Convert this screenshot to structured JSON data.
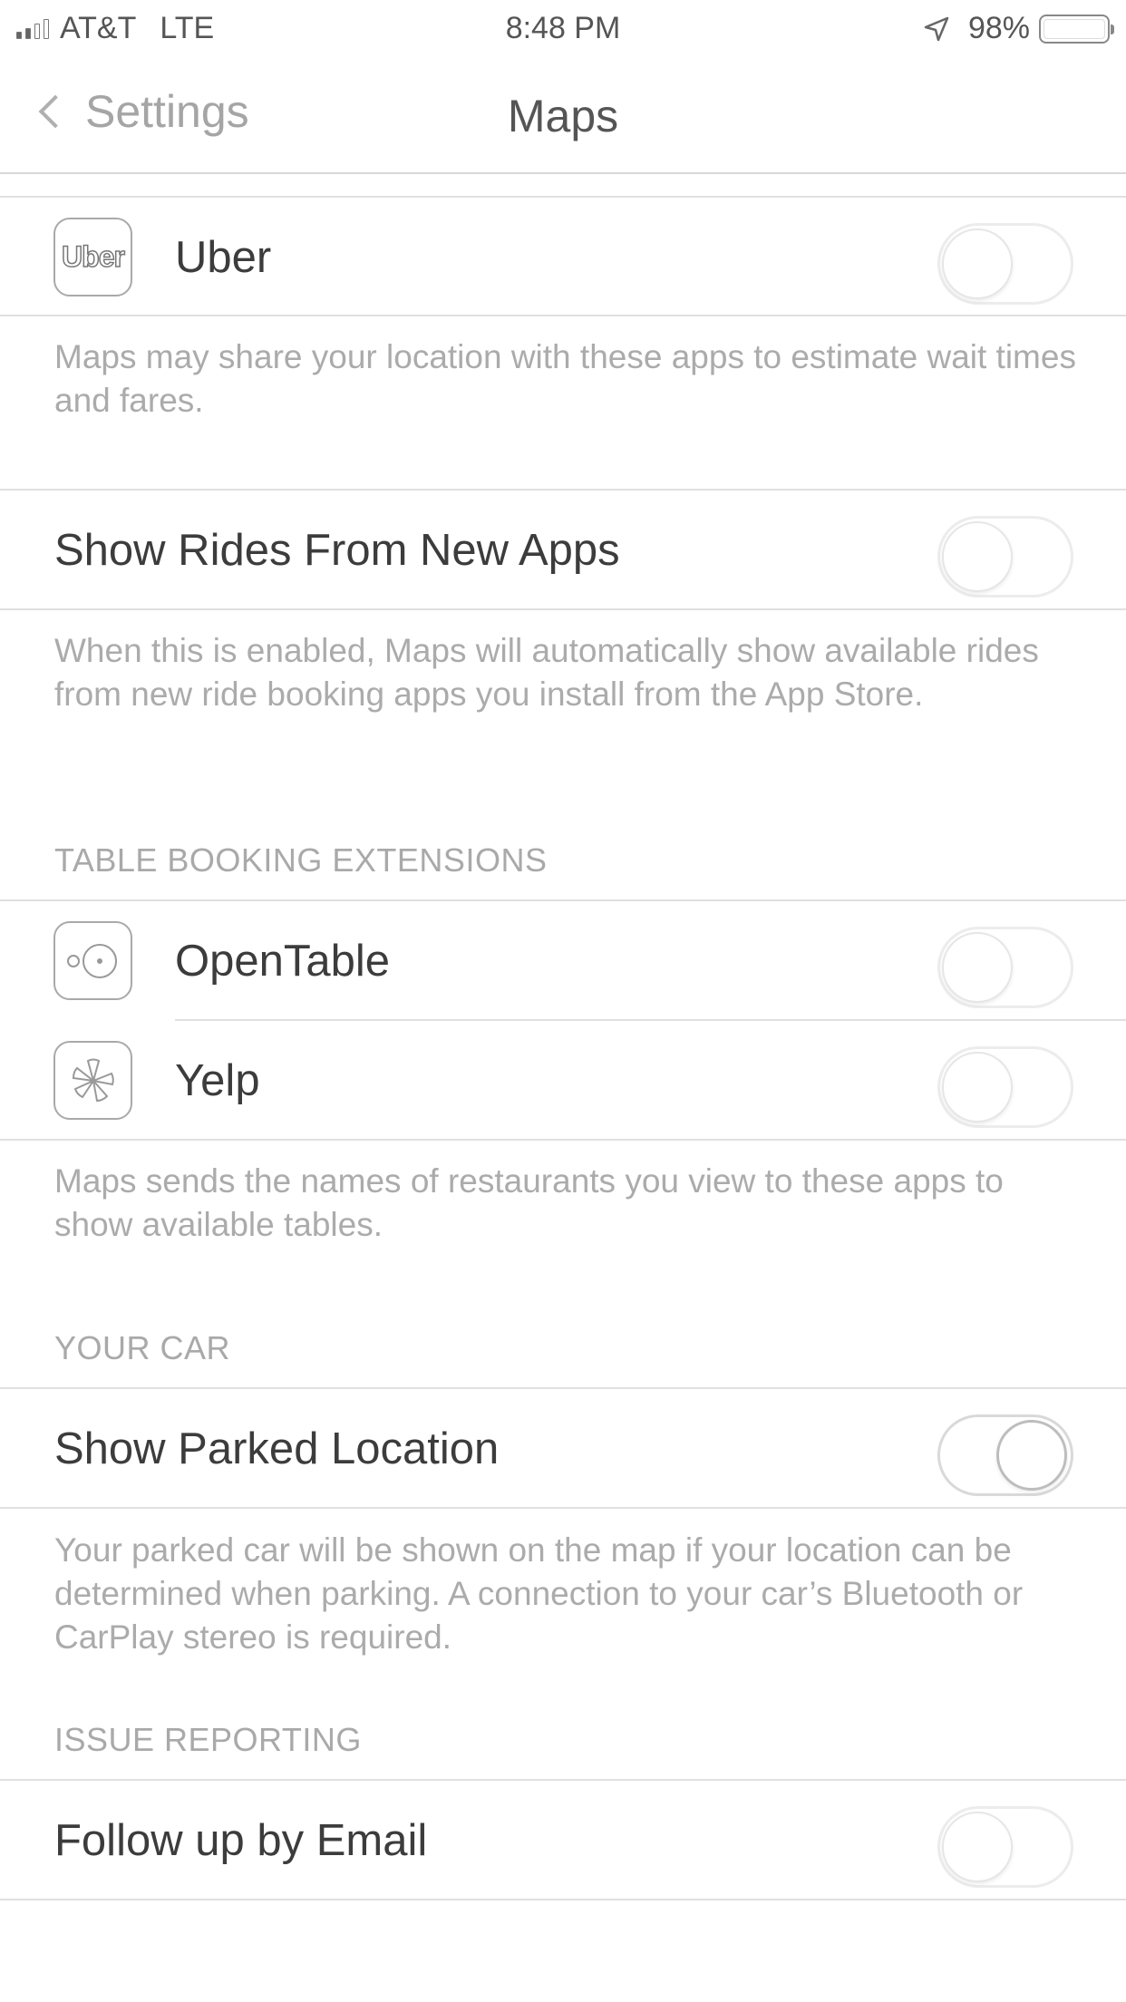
{
  "status_bar": {
    "carrier": "AT&T",
    "network": "LTE",
    "time": "8:48 PM",
    "battery": "98%",
    "battery_level": 0.98,
    "signal_bars_filled": 2,
    "signal_bars_total": 4
  },
  "nav": {
    "back_label": "Settings",
    "title": "Maps"
  },
  "ride_apps": {
    "items": [
      {
        "label": "Uber",
        "icon_text": "Uber",
        "icon": "uber-icon",
        "on": false
      }
    ],
    "footer": "Maps may share your location with these apps to estimate wait times and fares."
  },
  "new_apps": {
    "label": "Show Rides From New Apps",
    "on": false,
    "footer": "When this is enabled, Maps will automatically show available rides from new ride booking apps you install from the App Store."
  },
  "table_booking": {
    "header": "TABLE BOOKING EXTENSIONS",
    "items": [
      {
        "label": "OpenTable",
        "icon": "opentable-icon",
        "on": false
      },
      {
        "label": "Yelp",
        "icon": "yelp-icon",
        "on": false
      }
    ],
    "footer": "Maps sends the names of restaurants you view to these apps to show available tables."
  },
  "your_car": {
    "header": "YOUR CAR",
    "label": "Show Parked Location",
    "on": true,
    "footer": "Your parked car will be shown on the map if your location can be determined when parking. A connection to your car’s Bluetooth or CarPlay stereo is required."
  },
  "issue_reporting": {
    "header": "ISSUE REPORTING",
    "label": "Follow up by Email",
    "on": false
  }
}
